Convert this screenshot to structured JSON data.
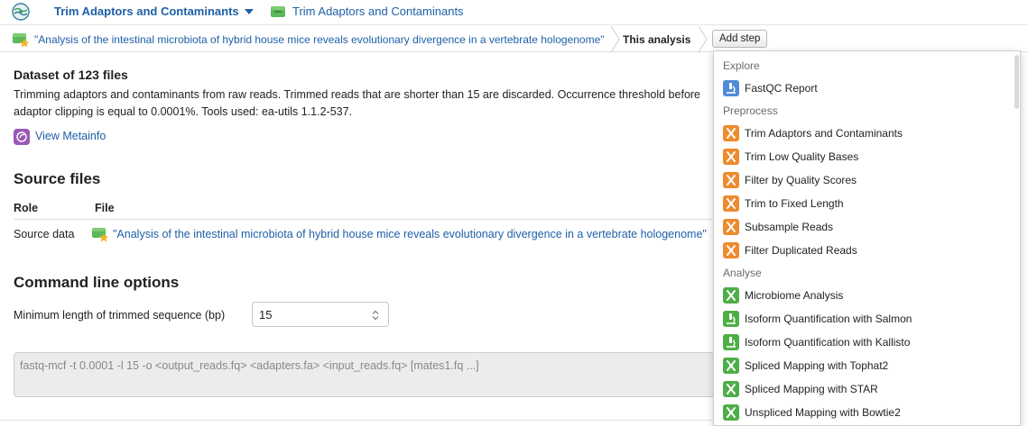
{
  "header": {
    "tool_title": "Trim Adaptors and Contaminants",
    "dataset_link": "Trim Adaptors and Contaminants"
  },
  "breadcrumb": {
    "parent": "\"Analysis of the intestinal microbiota of hybrid house mice reveals evolutionary divergence in a vertebrate hologenome\"",
    "current": "This analysis",
    "add_step_label": "Add step"
  },
  "dataset": {
    "title": "Dataset of 123 files",
    "description": "Trimming adaptors and contaminants from raw reads. Trimmed reads that are shorter than 15 are discarded. Occurrence threshold before adaptor clipping is equal to 0.0001%. Tools used: ea-utils 1.1.2-537.",
    "metainfo_link": "View Metainfo"
  },
  "source_files": {
    "heading": "Source files",
    "columns": [
      "Role",
      "File"
    ],
    "rows": [
      {
        "role": "Source data",
        "file": "\"Analysis of the intestinal microbiota of hybrid house mice reveals evolutionary divergence in a vertebrate hologenome\""
      }
    ]
  },
  "command_line": {
    "heading": "Command line options",
    "min_length_label": "Minimum length of trimmed sequence (bp)",
    "min_length_value": "15",
    "command": "fastq-mcf -t 0.0001 -l 15 -o <output_reads.fq> <adapters.fa> <input_reads.fq> [mates1.fq ...]"
  },
  "add_step_menu": {
    "sections": [
      {
        "header": "Explore",
        "items": [
          {
            "label": "FastQC Report",
            "icon": "microscope-icon",
            "color": "#4f8bd8"
          }
        ]
      },
      {
        "header": "Preprocess",
        "items": [
          {
            "label": "Trim Adaptors and Contaminants",
            "icon": "tool-icon",
            "color": "#ef8a2d"
          },
          {
            "label": "Trim Low Quality Bases",
            "icon": "tool-icon",
            "color": "#ef8a2d"
          },
          {
            "label": "Filter by Quality Scores",
            "icon": "tool-icon",
            "color": "#ef8a2d"
          },
          {
            "label": "Trim to Fixed Length",
            "icon": "tool-icon",
            "color": "#ef8a2d"
          },
          {
            "label": "Subsample Reads",
            "icon": "tool-icon",
            "color": "#ef8a2d"
          },
          {
            "label": "Filter Duplicated Reads",
            "icon": "tool-icon",
            "color": "#ef8a2d"
          }
        ]
      },
      {
        "header": "Analyse",
        "items": [
          {
            "label": "Microbiome Analysis",
            "icon": "tool-icon",
            "color": "#4fae47"
          },
          {
            "label": "Isoform Quantification with Salmon",
            "icon": "microscope-icon",
            "color": "#4fae47"
          },
          {
            "label": "Isoform Quantification with Kallisto",
            "icon": "microscope-icon",
            "color": "#4fae47"
          },
          {
            "label": "Spliced Mapping with Tophat2",
            "icon": "tool-icon",
            "color": "#4fae47"
          },
          {
            "label": "Spliced Mapping with STAR",
            "icon": "tool-icon",
            "color": "#4fae47"
          },
          {
            "label": "Unspliced Mapping with Bowtie2",
            "icon": "tool-icon",
            "color": "#4fae47"
          }
        ]
      }
    ]
  }
}
